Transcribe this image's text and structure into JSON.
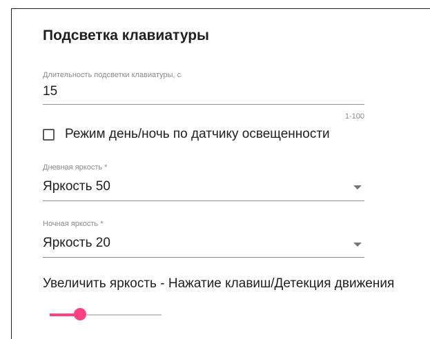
{
  "section": {
    "title": "Подсветка клавиатуры"
  },
  "duration_field": {
    "label": "Длительность подсветки клавиатуры, с",
    "value": "15",
    "hint": "1-100"
  },
  "day_night_checkbox": {
    "label": "Режим день/ночь по датчику освещенности",
    "checked": false
  },
  "day_brightness": {
    "label": "Дневная яркость *",
    "selected": "Яркость 50"
  },
  "night_brightness": {
    "label": "Ночная яркость *",
    "selected": "Яркость 20"
  },
  "boost_slider": {
    "label": "Увеличить яркость - Нажатие клавиш/Детекция движения",
    "fraction": 0.27
  },
  "colors": {
    "accent": "#ff4081",
    "text": "#202020",
    "secondary_text": "#8a8a8a",
    "divider": "#8f8f8f"
  },
  "icons": {
    "select_caret": "chevron-down-icon",
    "checkbox": "checkbox-unchecked-icon"
  }
}
